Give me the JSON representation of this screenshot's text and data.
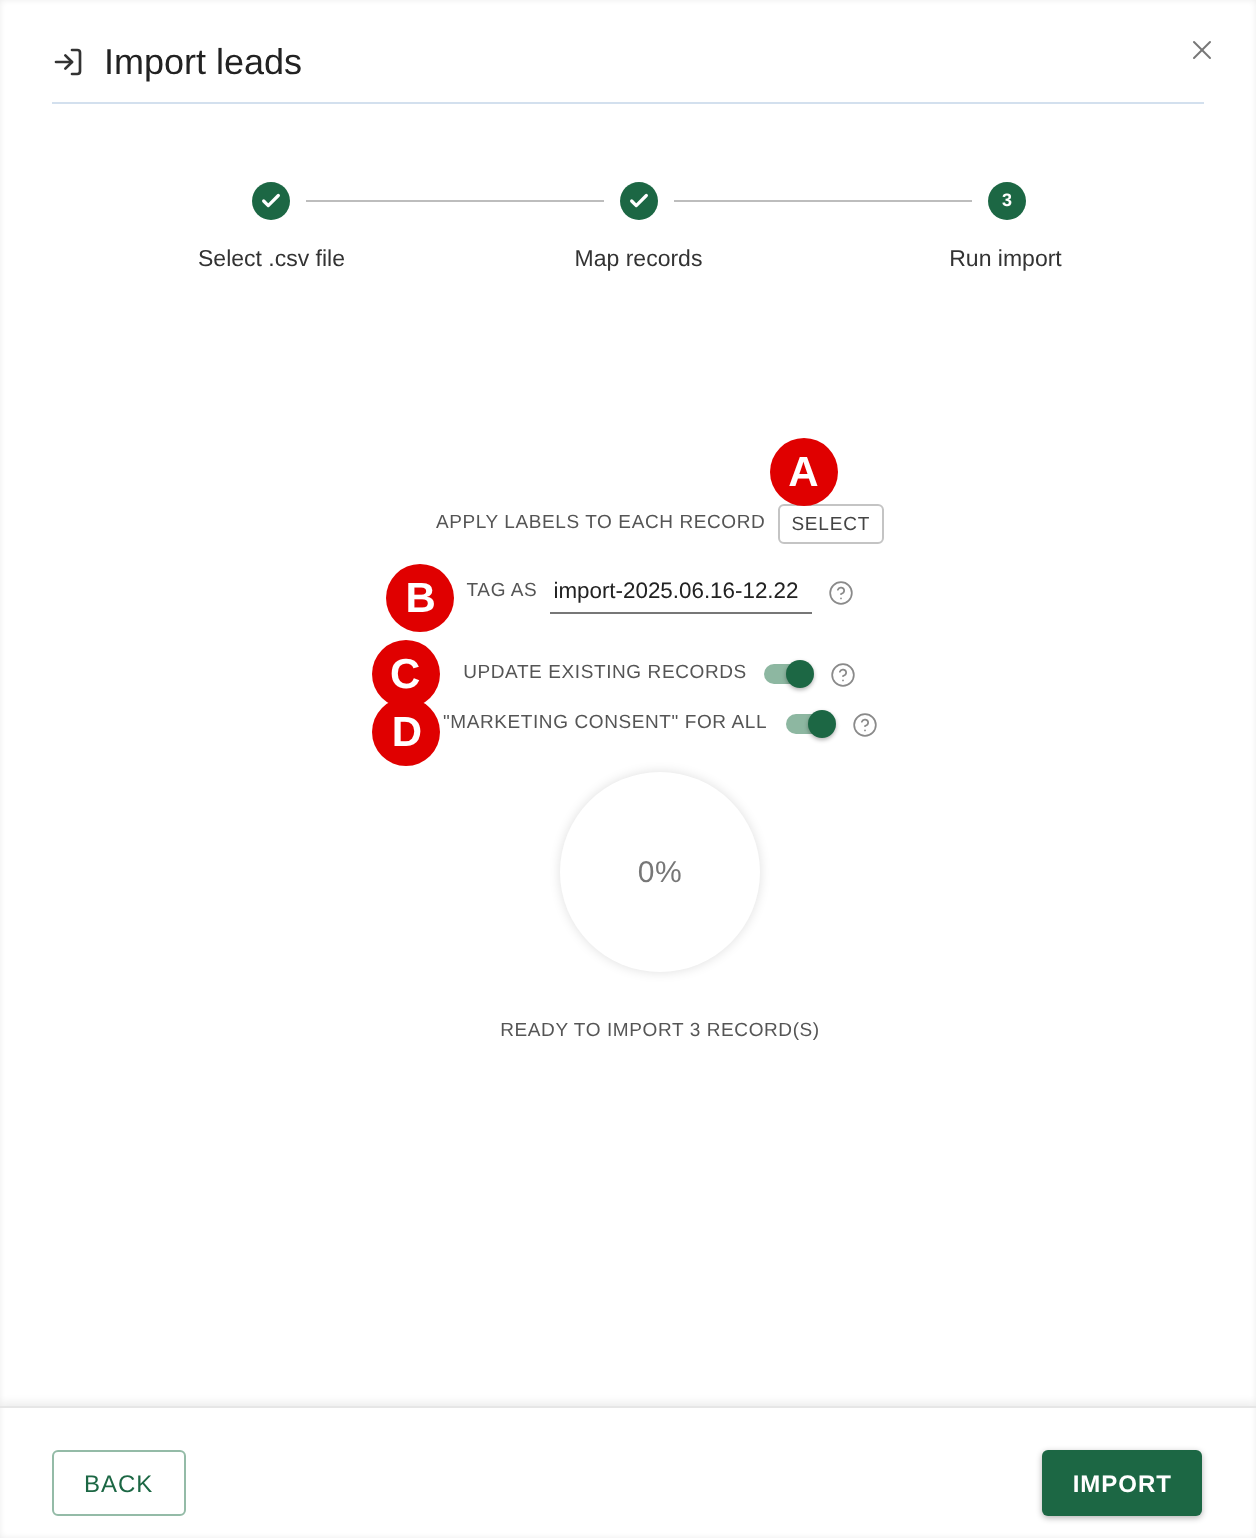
{
  "dialog": {
    "title": "Import leads"
  },
  "steps": [
    {
      "label": "Select .csv file",
      "completed": true,
      "current": false
    },
    {
      "label": "Map records",
      "completed": true,
      "current": false
    },
    {
      "label": "Run import",
      "completed": false,
      "current": true,
      "number": "3"
    }
  ],
  "options": [
    {
      "kind": "select",
      "label": "APPLY LABELS TO EACH RECORD",
      "button": "SELECT",
      "help": false,
      "marker": "A"
    },
    {
      "kind": "text",
      "label": "TAG AS",
      "value": "import-2025.06.16-12.22",
      "help": true,
      "marker": "B"
    },
    {
      "kind": "toggle",
      "label": "UPDATE EXISTING RECORDS",
      "on": true,
      "help": true,
      "marker": "C"
    },
    {
      "kind": "toggle",
      "label": "\"MARKETING CONSENT\" FOR ALL",
      "on": true,
      "help": true,
      "marker": "D"
    }
  ],
  "progress": {
    "reading": "0%",
    "status": "READY TO IMPORT 3 RECORD(S)"
  },
  "buttons": [
    {
      "kind": "outline",
      "label": "BACK"
    },
    {
      "kind": "primary",
      "label": "IMPORT"
    }
  ]
}
